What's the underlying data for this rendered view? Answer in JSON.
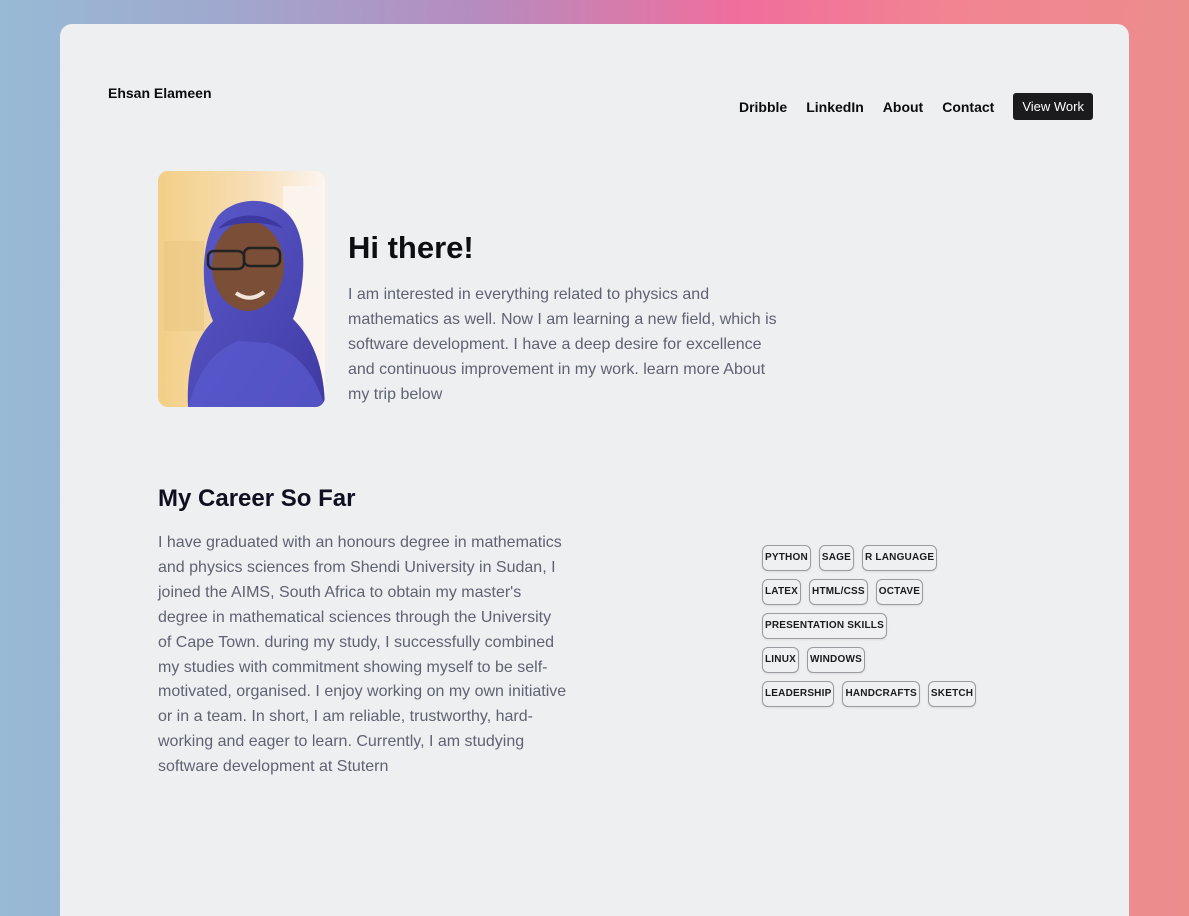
{
  "header": {
    "brand": "Ehsan Elameen",
    "nav": {
      "dribble": "Dribble",
      "linkedin": "LinkedIn",
      "about": "About",
      "contact": "Contact",
      "view_work": "View Work"
    }
  },
  "hero": {
    "title": "Hi there!",
    "text": "I am interested in everything related to physics and mathematics as well. Now I am learning a new field, which is software development. I have a deep desire for excellence and continuous improvement in my work. learn more About my trip below"
  },
  "career": {
    "title": "My Career So Far",
    "text": "I have graduated with an honours degree in mathematics and physics sciences from Shendi University in Sudan, I joined the AIMS, South Africa to obtain my master's degree in mathematical sciences through the University of Cape Town. during my study, I successfully combined my studies with commitment showing myself to be self-motivated, organised. I enjoy working on my own initiative or in a team. In short, I am reliable, trustworthy, hard-working and eager to learn. Currently, I am studying software development at Stutern"
  },
  "skills": [
    [
      "PYTHON",
      "SAGE",
      "R LANGUAGE"
    ],
    [
      "LATEX",
      "HTML/CSS",
      "OCTAVE"
    ],
    [
      "PRESENTATION SKILLS"
    ],
    [
      "LINUX",
      "WINDOWS"
    ],
    [
      "LEADERSHIP",
      "HANDCRAFTS",
      "SKETCH"
    ]
  ],
  "colors": {
    "card_background": "#eeeff1",
    "view_work_button": "#1b1b1d",
    "body_text": "#5f6272"
  }
}
